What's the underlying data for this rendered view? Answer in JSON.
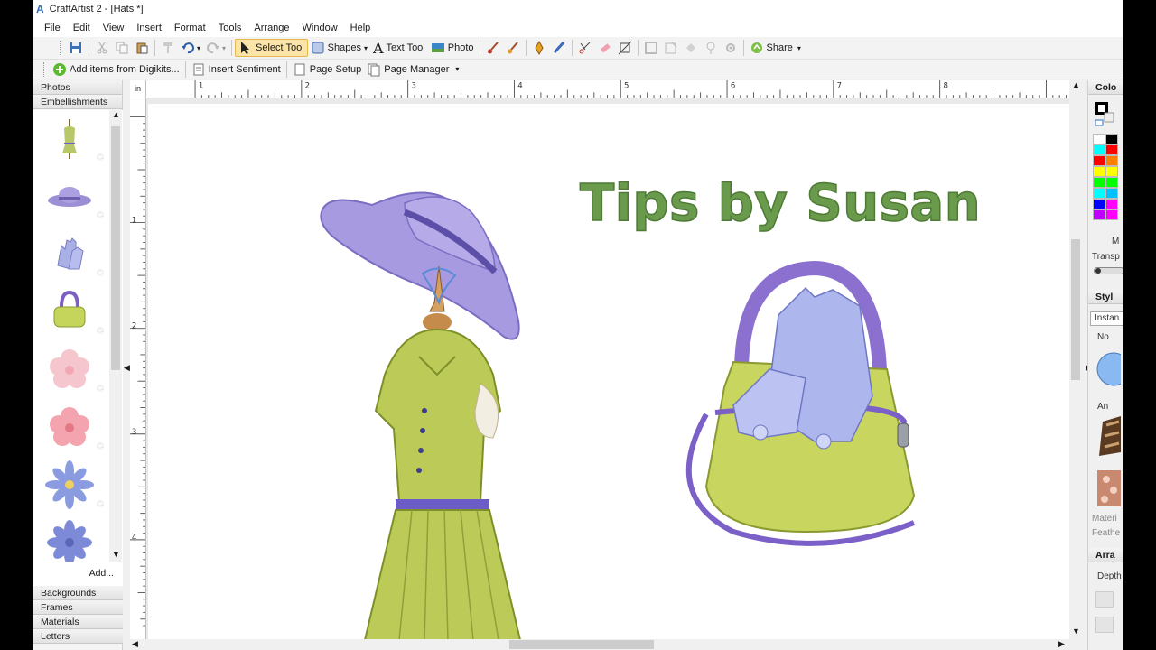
{
  "window": {
    "title": "CraftArtist 2 - [Hats *]"
  },
  "menu": [
    "File",
    "Edit",
    "View",
    "Insert",
    "Format",
    "Tools",
    "Arrange",
    "Window",
    "Help"
  ],
  "toolbar": {
    "select_tool": "Select Tool",
    "shapes": "Shapes",
    "text_tool": "Text Tool",
    "photo": "Photo",
    "share": "Share"
  },
  "toolbar2": {
    "add_items": "Add items from Digikits...",
    "insert_sentiment": "Insert Sentiment",
    "page_setup": "Page Setup",
    "page_manager": "Page Manager"
  },
  "left_panel": {
    "tabs_top": [
      "Photos",
      "Embellishments"
    ],
    "add_label": "Add...",
    "tabs_bottom": [
      "Backgrounds",
      "Frames",
      "Materials",
      "Letters"
    ],
    "items": [
      {
        "icon": "dress-form-icon"
      },
      {
        "icon": "hat-icon"
      },
      {
        "icon": "gloves-icon"
      },
      {
        "icon": "handbag-icon"
      },
      {
        "icon": "flower-pink-light-icon"
      },
      {
        "icon": "flower-pink-icon"
      },
      {
        "icon": "flower-blue-icon"
      },
      {
        "icon": "flower-lavender-icon"
      }
    ]
  },
  "ruler": {
    "unit": "in",
    "top_labels": [
      "1",
      "2",
      "3",
      "4",
      "5",
      "6",
      "7",
      "8"
    ],
    "left_labels": [
      "1",
      "2",
      "3",
      "4"
    ]
  },
  "canvas": {
    "title_text": "Tips by Susan"
  },
  "right_panel": {
    "colour_head": "Colo",
    "m_label": "M",
    "transparency": "Transp",
    "styles_head": "Styl",
    "instant": "Instan",
    "no": "No",
    "an": "An",
    "materials": "Materi",
    "feather": "Feathe",
    "arrange_head": "Arra",
    "depth": "Depth",
    "colors": [
      "#ffffff",
      "#000000",
      "#00ffff",
      "#ff0000",
      "#ff0000",
      "#ff8000",
      "#ffff00",
      "#ffff00",
      "#00ff00",
      "#00ff00",
      "#00ffff",
      "#00c0ff",
      "#0000ff",
      "#ff00ff",
      "#c000ff",
      "#ff00ff"
    ]
  }
}
